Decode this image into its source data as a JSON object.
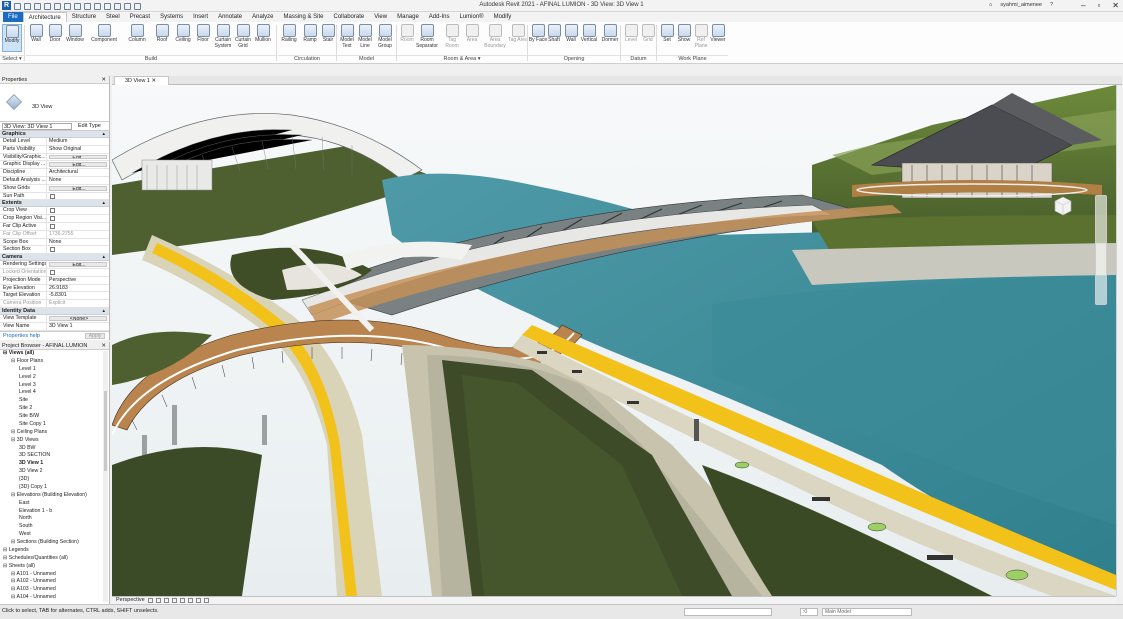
{
  "window": {
    "title": "Autodesk Revit 2021 - AFINAL LUMION - 3D View: 3D View 1",
    "user": "syahmi_aimenee",
    "help": "?"
  },
  "ribbon_tabs": [
    "File",
    "Architecture",
    "Structure",
    "Steel",
    "Precast",
    "Systems",
    "Insert",
    "Annotate",
    "Analyze",
    "Massing & Site",
    "Collaborate",
    "View",
    "Manage",
    "Add-Ins",
    "Lumion®",
    "Modify"
  ],
  "ribbon_buttons": {
    "modify": "Modify",
    "wall": "Wall",
    "door": "Door",
    "window": "Window",
    "component": "Component",
    "column": "Column",
    "roof": "Roof",
    "ceiling": "Ceiling",
    "floor": "Floor",
    "curtain_system": "Curtain System",
    "curtain_grid": "Curtain Grid",
    "mullion": "Mullion",
    "railing": "Railing",
    "ramp": "Ramp",
    "stair": "Stair",
    "model_text": "Model Text",
    "model_line": "Model Line",
    "model_group": "Model Group",
    "room": "Room",
    "room_separator": "Room Separator",
    "tag_room": "Tag Room",
    "area": "Area",
    "area_boundary": "Area Boundary",
    "tag_area": "Tag Area",
    "by_face": "By Face",
    "shaft": "Shaft",
    "wall_opening": "Wall",
    "vertical": "Vertical",
    "dormer": "Dormer",
    "level": "Level",
    "grid": "Grid",
    "set": "Set",
    "show": "Show",
    "ref_plane": "Ref Plane",
    "viewer": "Viewer"
  },
  "ribbon_panels": {
    "select": "Select ▾",
    "build": "Build",
    "circulation": "Circulation",
    "model": "Model",
    "room_area": "Room & Area ▾",
    "opening": "Opening",
    "datum": "Datum",
    "work_plane": "Work Plane"
  },
  "properties": {
    "header": "Properties",
    "type_name": "3D View",
    "instance_selector": "3D View: 3D View 1",
    "edit_type": "Edit Type",
    "sections": {
      "graphics": "Graphics",
      "extents": "Extents",
      "camera": "Camera",
      "identity": "Identity Data"
    },
    "graphics_rows": [
      {
        "k": "Detail Level",
        "v": "Medium"
      },
      {
        "k": "Parts Visibility",
        "v": "Show Original"
      },
      {
        "k": "Visibility/Graphic...",
        "v": "Edit..."
      },
      {
        "k": "Graphic Display ...",
        "v": "Edit..."
      },
      {
        "k": "Discipline",
        "v": "Architectural"
      },
      {
        "k": "Default Analysis ...",
        "v": "None"
      },
      {
        "k": "Show Grids",
        "v": "Edit..."
      },
      {
        "k": "Sun Path",
        "v": ""
      }
    ],
    "extents_rows": [
      {
        "k": "Crop View",
        "v": ""
      },
      {
        "k": "Crop Region Visi...",
        "v": ""
      },
      {
        "k": "Far Clip Active",
        "v": ""
      },
      {
        "k": "Far Clip Offset",
        "v": "1736.2755"
      },
      {
        "k": "Scope Box",
        "v": "None"
      },
      {
        "k": "Section Box",
        "v": ""
      }
    ],
    "camera_rows": [
      {
        "k": "Rendering Settings",
        "v": "Edit..."
      },
      {
        "k": "Locked Orientation",
        "v": ""
      },
      {
        "k": "Projection Mode",
        "v": "Perspective"
      },
      {
        "k": "Eye Elevation",
        "v": "26.9183"
      },
      {
        "k": "Target Elevation",
        "v": "-5.8301"
      },
      {
        "k": "Camera Position",
        "v": "Explicit"
      }
    ],
    "identity_rows": [
      {
        "k": "View Template",
        "v": "<None>"
      },
      {
        "k": "View Name",
        "v": "3D View 1"
      }
    ],
    "help_link": "Properties help",
    "apply": "Apply"
  },
  "project_browser": {
    "header": "Project Browser - AFINAL LUMION",
    "items": [
      {
        "label": "Views (all)",
        "level": 0,
        "bold": true
      },
      {
        "label": "Floor Plans",
        "level": 1
      },
      {
        "label": "Level 1",
        "level": 2
      },
      {
        "label": "Level 2",
        "level": 2
      },
      {
        "label": "Level 3",
        "level": 2
      },
      {
        "label": "Level 4",
        "level": 2
      },
      {
        "label": "Site",
        "level": 2
      },
      {
        "label": "Site 2",
        "level": 2
      },
      {
        "label": "Site B/W",
        "level": 2
      },
      {
        "label": "Site Copy 1",
        "level": 2
      },
      {
        "label": "Ceiling Plans",
        "level": 1
      },
      {
        "label": "3D Views",
        "level": 1
      },
      {
        "label": "3D BW",
        "level": 2
      },
      {
        "label": "3D SECTION",
        "level": 2
      },
      {
        "label": "3D View 1",
        "level": 2,
        "bold": true
      },
      {
        "label": "3D View 2",
        "level": 2
      },
      {
        "label": "{3D}",
        "level": 2
      },
      {
        "label": "{3D} Copy 1",
        "level": 2
      },
      {
        "label": "Elevations (Building Elevation)",
        "level": 1
      },
      {
        "label": "East",
        "level": 2
      },
      {
        "label": "Elevation 1 - b",
        "level": 2
      },
      {
        "label": "North",
        "level": 2
      },
      {
        "label": "South",
        "level": 2
      },
      {
        "label": "West",
        "level": 2
      },
      {
        "label": "Sections (Building Section)",
        "level": 1
      },
      {
        "label": "Legends",
        "level": 0
      },
      {
        "label": "Schedules/Quantities (all)",
        "level": 0
      },
      {
        "label": "Sheets (all)",
        "level": 0
      },
      {
        "label": "A101 - Unnamed",
        "level": 1
      },
      {
        "label": "A102 - Unnamed",
        "level": 1
      },
      {
        "label": "A103 - Unnamed",
        "level": 1
      },
      {
        "label": "A104 - Unnamed",
        "level": 1
      }
    ]
  },
  "view_tab": "3D View 1",
  "view_controls": "Perspective",
  "status": {
    "text": "Click to select, TAB for alternates, CTRL adds, SHIFT unselects.",
    "model": "Main Model",
    "workset": ":0"
  },
  "colors": {
    "accent": "#1b6cc1",
    "water": "#3f8e9c",
    "grass": "#4c5a2e",
    "path_yellow": "#f2c21a"
  }
}
